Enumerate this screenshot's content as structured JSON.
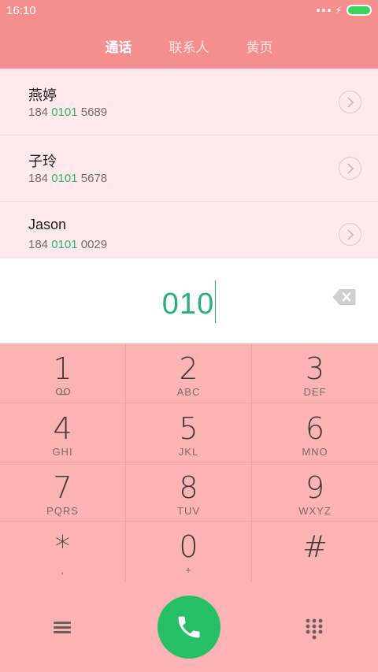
{
  "status_bar": {
    "time": "16:10"
  },
  "tabs": [
    {
      "label": "通话",
      "active": true
    },
    {
      "label": "联系人",
      "active": false
    },
    {
      "label": "黄页",
      "active": false
    }
  ],
  "contacts": [
    {
      "name": "燕婷",
      "number_prefix": "184 ",
      "number_match": "0101",
      "number_suffix": " 5689"
    },
    {
      "name": "子玲",
      "number_prefix": "184 ",
      "number_match": "0101",
      "number_suffix": " 5678"
    },
    {
      "name": "Jason",
      "number_prefix": "184 ",
      "number_match": "0101",
      "number_suffix": " 0029"
    }
  ],
  "dial_input": {
    "value": "010"
  },
  "keypad": [
    {
      "digit": "1",
      "letters": ""
    },
    {
      "digit": "2",
      "letters": "ABC"
    },
    {
      "digit": "3",
      "letters": "DEF"
    },
    {
      "digit": "4",
      "letters": "GHI"
    },
    {
      "digit": "5",
      "letters": "JKL"
    },
    {
      "digit": "6",
      "letters": "MNO"
    },
    {
      "digit": "7",
      "letters": "PQRS"
    },
    {
      "digit": "8",
      "letters": "TUV"
    },
    {
      "digit": "9",
      "letters": "WXYZ"
    },
    {
      "digit": "*",
      "letters": ","
    },
    {
      "digit": "0",
      "letters": "+"
    },
    {
      "digit": "#",
      "letters": ""
    }
  ],
  "icons": {
    "voicemail": "voicemail-icon",
    "backspace": "backspace-icon",
    "menu": "menu-icon",
    "call": "phone-icon",
    "keypad_toggle": "dialpad-icon",
    "chevron": "chevron-right-icon"
  },
  "colors": {
    "header": "#f58f8f",
    "results_bg": "#ffe9ee",
    "keypad_bg": "#fdb3b3",
    "highlight": "#2ab86a",
    "call_button": "#26bf66",
    "battery": "#39d55a"
  }
}
